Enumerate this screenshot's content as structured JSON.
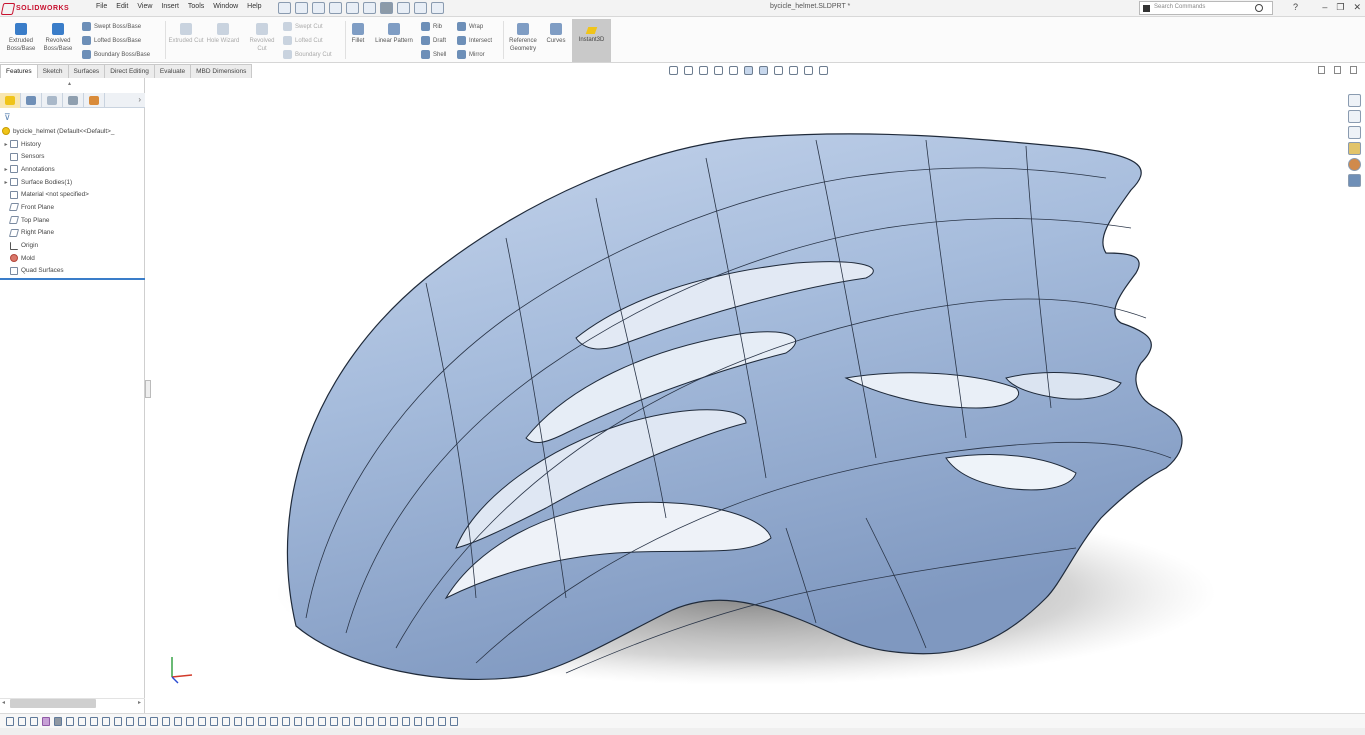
{
  "app": {
    "brand": "SOLIDWORKS",
    "document_title": "bycicle_helmet.SLDPRT *"
  },
  "menu": [
    "File",
    "Edit",
    "View",
    "Insert",
    "Tools",
    "Window",
    "Help"
  ],
  "search": {
    "placeholder": "Search Commands",
    "help_label": "?"
  },
  "window_controls": [
    "–",
    "❐",
    "✕"
  ],
  "ribbon": {
    "big_buttons": [
      {
        "label": "Extruded Boss/Base"
      },
      {
        "label": "Revolved Boss/Base"
      }
    ],
    "row_buttons": [
      {
        "label": "Swept Boss/Base",
        "dim": false
      },
      {
        "label": "Lofted Boss/Base",
        "dim": false
      },
      {
        "label": "Boundary Boss/Base",
        "dim": false
      }
    ],
    "cut_buttons": [
      {
        "label": "Extruded Cut"
      },
      {
        "label": "Hole Wizard"
      },
      {
        "label": "Revolved Cut"
      }
    ],
    "cut_rows": [
      {
        "label": "Swept Cut"
      },
      {
        "label": "Lofted Cut"
      },
      {
        "label": "Boundary Cut"
      }
    ],
    "feature_buttons": [
      {
        "label": "Fillet"
      },
      {
        "label": "Linear Pattern"
      }
    ],
    "feature_rows": [
      {
        "label": "Rib"
      },
      {
        "label": "Draft"
      },
      {
        "label": "Shell"
      },
      {
        "label": "Wrap"
      },
      {
        "label": "Intersect"
      },
      {
        "label": "Mirror"
      }
    ],
    "geometry_buttons": [
      {
        "label": "Reference Geometry"
      },
      {
        "label": "Curves"
      }
    ],
    "active_button": {
      "label": "Instant3D"
    }
  },
  "tabs": [
    {
      "label": "Features",
      "active": true
    },
    {
      "label": "Sketch",
      "active": false
    },
    {
      "label": "Surfaces",
      "active": false
    },
    {
      "label": "Direct Editing",
      "active": false
    },
    {
      "label": "Evaluate",
      "active": false
    },
    {
      "label": "MBD Dimensions",
      "active": false
    }
  ],
  "feature_tree": [
    {
      "label": "bycicle_helmet  (Default<<Default>_",
      "icon": "part-icon",
      "exp": ""
    },
    {
      "label": "History",
      "icon": "history-icon",
      "exp": "▸"
    },
    {
      "label": "Sensors",
      "icon": "sensors-icon",
      "exp": ""
    },
    {
      "label": "Annotations",
      "icon": "annotations-icon",
      "exp": "▸"
    },
    {
      "label": "Surface Bodies(1)",
      "icon": "surface-bodies-icon",
      "exp": "▸"
    },
    {
      "label": "Material <not specified>",
      "icon": "material-icon",
      "exp": ""
    },
    {
      "label": "Front Plane",
      "icon": "plane-icon",
      "exp": ""
    },
    {
      "label": "Top Plane",
      "icon": "plane-icon",
      "exp": ""
    },
    {
      "label": "Right Plane",
      "icon": "plane-icon",
      "exp": ""
    },
    {
      "label": "Origin",
      "icon": "origin-icon",
      "exp": ""
    },
    {
      "label": "Mold",
      "icon": "mold-icon",
      "exp": ""
    },
    {
      "label": "Quad Surfaces",
      "icon": "quad-surface-icon",
      "exp": ""
    }
  ],
  "colors": {
    "accent": "#3a7dc9",
    "helmet_surface": "#9fb6d8",
    "brand_red": "#c8102e"
  }
}
